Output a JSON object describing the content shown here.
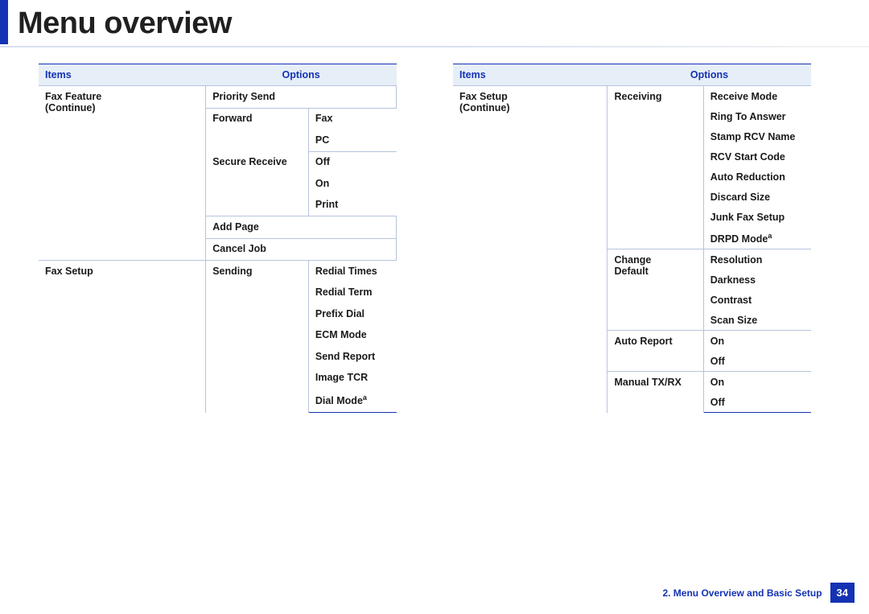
{
  "title": "Menu overview",
  "footer": {
    "chapter": "2.  Menu Overview and Basic Setup",
    "page": "34"
  },
  "headers": {
    "items": "Items",
    "options": "Options"
  },
  "left": {
    "item1_l1": "Fax Feature",
    "item1_l2": "(Continue)",
    "prio": "Priority Send",
    "forward": "Forward",
    "fax": "Fax",
    "pc": "PC",
    "secrecv": "Secure Receive",
    "off": "Off",
    "on": "On",
    "print": "Print",
    "addpage": "Add Page",
    "canceljob": "Cancel Job",
    "item2": "Fax Setup",
    "sending": "Sending",
    "redialtimes": "Redial Times",
    "redialterm": "Redial Term",
    "prefixdial": "Prefix Dial",
    "ecm": "ECM Mode",
    "sendreport": "Send Report",
    "imagetcr": "Image TCR",
    "dialmode": "Dial Mode",
    "fn_a": "a"
  },
  "right": {
    "item1_l1": "Fax Setup",
    "item1_l2": "(Continue)",
    "receiving": "Receiving",
    "recvmode": "Receive Mode",
    "ringans": "Ring To Answer",
    "stamp": "Stamp RCV Name",
    "rcvstart": "RCV Start Code",
    "autored": "Auto Reduction",
    "discard": "Discard Size",
    "junk": "Junk Fax Setup",
    "drpd": "DRPD Mode",
    "fn_a": "a",
    "changedef_l1": "Change",
    "changedef_l2": "Default",
    "resolution": "Resolution",
    "darkness": "Darkness",
    "contrast": "Contrast",
    "scansize": "Scan Size",
    "autoreport": "Auto Report",
    "on": "On",
    "off": "Off",
    "manualtxrx": "Manual TX/RX"
  }
}
